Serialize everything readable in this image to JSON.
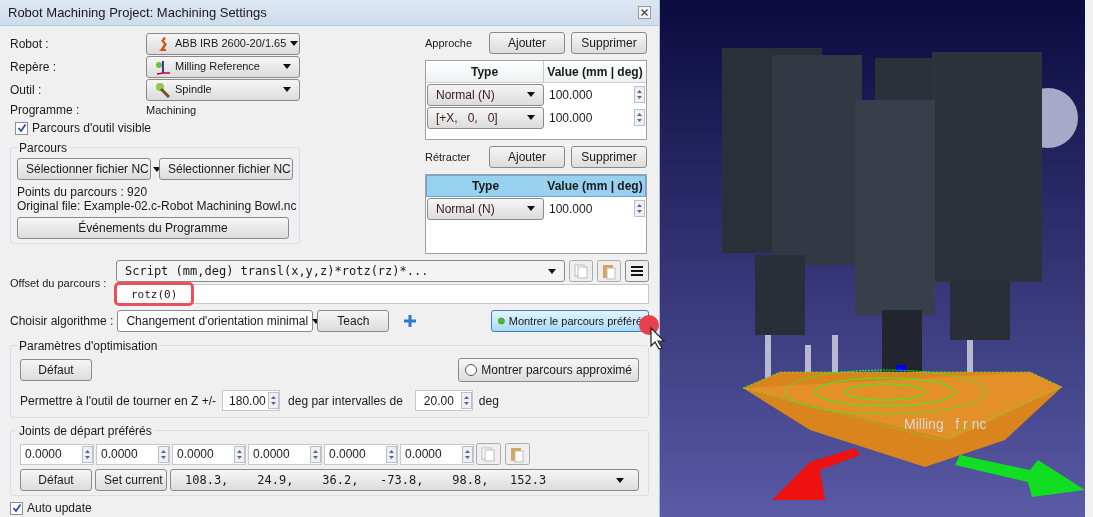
{
  "window": {
    "title": "Robot Machining Project: Machining Settings"
  },
  "settings": [
    {
      "label": "Robot :",
      "value": "ABB IRB 2600-20/1.65",
      "kind": "robot"
    },
    {
      "label": "Repère :",
      "value": "Milling Reference",
      "kind": "frame"
    },
    {
      "label": "Outil :",
      "value": "Spindle",
      "kind": "tool"
    }
  ],
  "program": {
    "label": "Programme :",
    "value": "Machining"
  },
  "toolpath_visible": {
    "label": "Parcours d'outil visible",
    "checked": true
  },
  "path_group": {
    "title": "Parcours",
    "nc_dropdown": "Sélectionner fichier NC",
    "nc_button": "Sélectionner fichier NC",
    "points": "Points du parcours : 920",
    "original_file": "Original file: Example-02.c-Robot Machining Bowl.nc",
    "events_button": "Événements du Programme"
  },
  "approach": {
    "label": "Approche",
    "add_button": "Ajouter",
    "remove_button": "Supprimer",
    "header_selected": false,
    "columns": [
      "Type",
      "Value (mm | deg)"
    ],
    "rows": [
      {
        "type": "Normal (N)",
        "value": "100.000"
      },
      {
        "type": "[+X,   0,   0]",
        "value": "100.000"
      }
    ]
  },
  "retract": {
    "label": "Rétracter",
    "add_button": "Ajouter",
    "remove_button": "Supprimer",
    "header_selected": true,
    "columns": [
      "Type",
      "Value (mm | deg)"
    ],
    "rows": [
      {
        "type": "Normal (N)",
        "value": "100.000"
      }
    ]
  },
  "offset": {
    "label": "Offset du parcours :",
    "script": "Script (mm,deg) transl(x,y,z)*rotz(rz)*...",
    "expression": "rotz(0)"
  },
  "algorithm": {
    "label": "Choisir algorithme :",
    "value": "Changement d'orientation minimal",
    "teach_button": "Teach",
    "show_preferred_button": "Montrer le parcours préféré"
  },
  "optimization": {
    "title": "Paramètres d'optimisation",
    "default_button": "Défaut",
    "approx_path": {
      "label": "Montrer parcours approximé",
      "checked": false
    },
    "rotate_label": "Permettre à l'outil de tourner en Z +/-",
    "rotate_value": "180.00",
    "interval_label": "deg par intervalles de",
    "interval_value": "20.00",
    "unit": "deg"
  },
  "start_joints": {
    "title": "Joints de départ préférés",
    "values": [
      "0.0000",
      "0.0000",
      "0.0000",
      "0.0000",
      "0.0000",
      "0.0000"
    ],
    "default_button": "Défaut",
    "set_current_button": "Set current",
    "current": "108.3,    24.9,    36.2,   -73.8,    98.8,   152.3"
  },
  "auto_update": {
    "label": "Auto update",
    "checked": true
  },
  "viewport": {
    "label": "Milling   f r nc"
  }
}
